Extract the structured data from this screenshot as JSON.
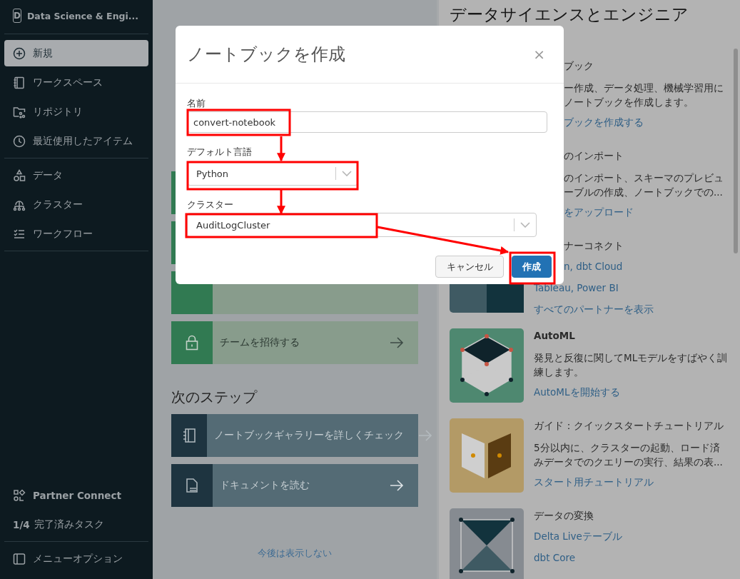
{
  "sidebar": {
    "workspace": {
      "badge": "D",
      "name": "Data Science & Engi..."
    },
    "nav_groups": [
      [
        {
          "label": "新規",
          "selected": true
        },
        {
          "label": "ワークスペース",
          "selected": false
        },
        {
          "label": "リポジトリ",
          "selected": false
        },
        {
          "label": "最近使用したアイテム",
          "selected": false
        }
      ],
      [
        {
          "label": "データ",
          "selected": false
        },
        {
          "label": "クラスター",
          "selected": false
        },
        {
          "label": "ワークフロー",
          "selected": false
        }
      ]
    ],
    "partner_connect": "Partner Connect",
    "tasks": {
      "count": "1/4",
      "label": "完了済みタスク"
    },
    "menu_options": "メニューオプション"
  },
  "getting_started_cards": [
    {
      "label": "チームを招待する"
    }
  ],
  "next_steps": {
    "title": "次のステップ",
    "cards": [
      {
        "label": "ノートブックギャラリーを詳しくチェック"
      },
      {
        "label": "ドキュメントを読む"
      }
    ]
  },
  "dismiss_link": "今後は表示しない",
  "right_panel": {
    "title": "データサイエンスとエンジニア",
    "items": [
      {
        "kind": "partial",
        "title": "ブック",
        "description_lines": [
          "ー作成、データ処理、機械学習用に",
          "ノートブックを作成します。"
        ],
        "links": [
          {
            "text": "ブックを作成する",
            "kind": "partial"
          }
        ]
      },
      {
        "kind": "partial",
        "title": "のインポート",
        "description_lines": [
          "のインポート、スキーマのプレビュ",
          "ーブルの作成、ノートブックでの..."
        ],
        "links": [
          {
            "text": "をアップロード",
            "kind": "partial"
          }
        ]
      },
      {
        "kind": "partial",
        "title": "ナーコネクト",
        "links": [
          {
            "text": "n, dbt Cloud",
            "kind": "partial"
          },
          {
            "text": "Tableau, Power BI",
            "kind": "full"
          },
          {
            "text": "すべてのパートナーを表示",
            "kind": "full"
          }
        ]
      },
      {
        "kind": "full",
        "title": "AutoML",
        "description_lines": [
          "発見と反復に関してMLモデルをすばやく訓",
          "練します。"
        ],
        "links": [
          {
            "text": "AutoMLを開始する",
            "kind": "full"
          }
        ]
      },
      {
        "kind": "full",
        "title": "ガイド：クイックスタートチュートリアル",
        "description_lines": [
          "5分以内に、クラスターの起動、ロード済",
          "みデータでのクエリーの実行、結果の表..."
        ],
        "links": [
          {
            "text": "スタート用チュートリアル",
            "kind": "full"
          }
        ]
      },
      {
        "kind": "full",
        "title": "データの変換",
        "links": [
          {
            "text": "Delta Liveテーブル",
            "kind": "full"
          },
          {
            "text": "dbt Core",
            "kind": "full"
          }
        ]
      }
    ]
  },
  "dialog": {
    "title": "ノートブックを作成",
    "close": "×",
    "fields": [
      {
        "label": "名前",
        "kind": "text",
        "value": "convert-notebook"
      },
      {
        "label": "デフォルト言語",
        "kind": "select",
        "value": "Python"
      },
      {
        "label": "クラスター",
        "kind": "select",
        "value": "AuditLogCluster"
      }
    ],
    "buttons": [
      {
        "label": "キャンセル",
        "kind": "secondary"
      },
      {
        "label": "作成",
        "kind": "primary"
      }
    ]
  }
}
